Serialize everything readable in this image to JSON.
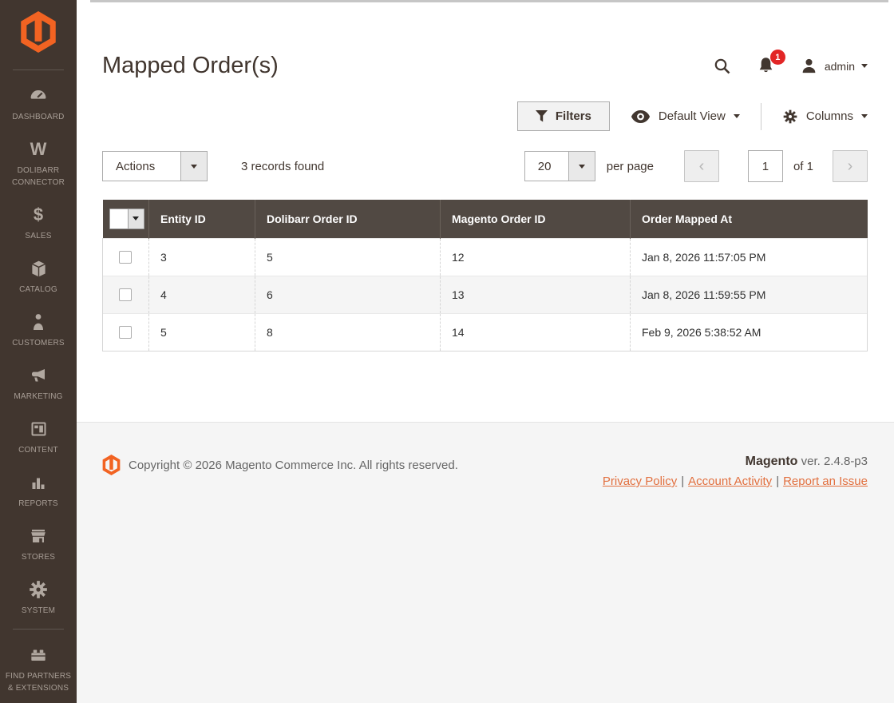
{
  "sidebar": {
    "items": [
      {
        "label": "DASHBOARD"
      },
      {
        "label": "DOLIBARR CONNECTOR"
      },
      {
        "label": "SALES"
      },
      {
        "label": "CATALOG"
      },
      {
        "label": "CUSTOMERS"
      },
      {
        "label": "MARKETING"
      },
      {
        "label": "CONTENT"
      },
      {
        "label": "REPORTS"
      },
      {
        "label": "STORES"
      },
      {
        "label": "SYSTEM"
      },
      {
        "label": "FIND PARTNERS & EXTENSIONS"
      }
    ],
    "dolibarr_icon_letter": "W",
    "sales_icon_symbol": "$"
  },
  "header": {
    "title": "Mapped Order(s)",
    "notification_count": "1",
    "username": "admin"
  },
  "grid_controls": {
    "filters": "Filters",
    "default_view": "Default View",
    "columns": "Columns"
  },
  "grid_toolbar": {
    "actions": "Actions",
    "records_found": "3 records found",
    "page_size": "20",
    "per_page": "per page",
    "prev_symbol": "‹",
    "next_symbol": "›",
    "current_page": "1",
    "of_pages": "of 1"
  },
  "table": {
    "columns": [
      "Entity ID",
      "Dolibarr Order ID",
      "Magento Order ID",
      "Order Mapped At"
    ],
    "rows": [
      [
        "3",
        "5",
        "12",
        "Jan 8, 2026 11:57:05 PM"
      ],
      [
        "4",
        "6",
        "13",
        "Jan 8, 2026 11:59:55 PM"
      ],
      [
        "5",
        "8",
        "14",
        "Feb 9, 2026 5:38:52 AM"
      ]
    ]
  },
  "footer": {
    "copyright": "Copyright © 2026 Magento Commerce Inc. All rights reserved.",
    "brand": "Magento",
    "version": "ver. 2.4.8-p3",
    "links": [
      "Privacy Policy",
      "Account Activity",
      "Report an Issue"
    ],
    "separator": "|"
  },
  "colors": {
    "accent_orange": "#f26322",
    "sidebar_bg": "#41362f",
    "grid_header_bg": "#514943",
    "badge_red": "#e22626",
    "link_orange": "#e2703f"
  }
}
